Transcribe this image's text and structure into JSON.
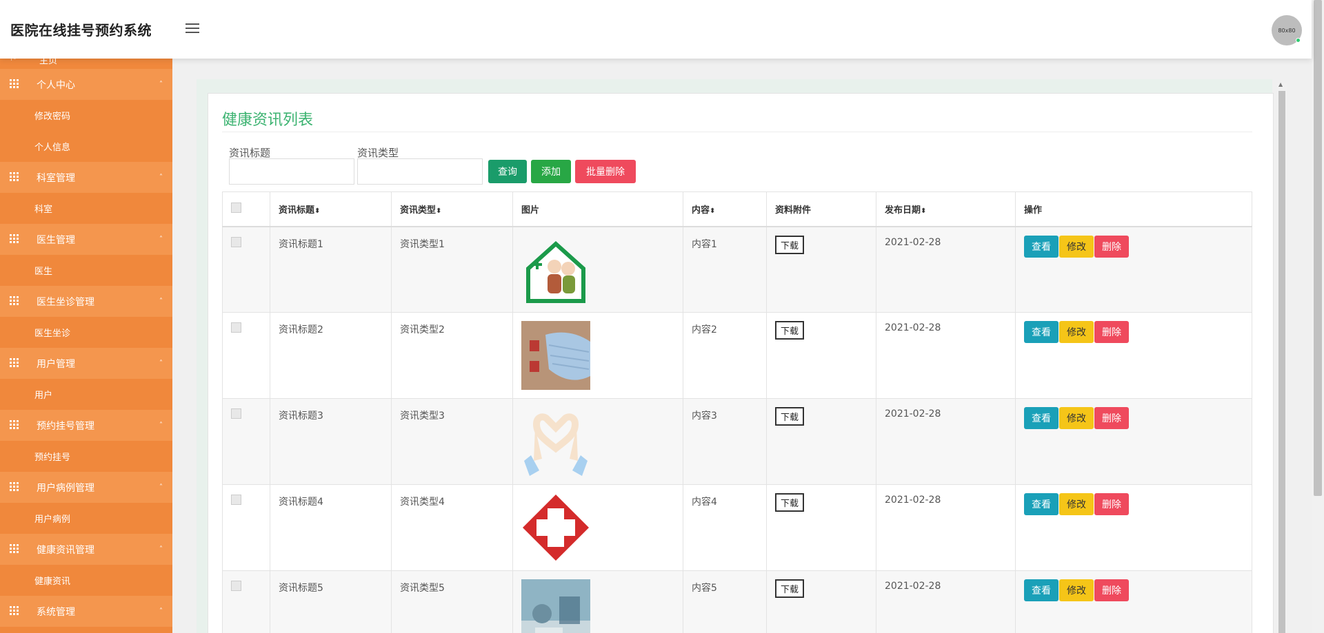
{
  "app": {
    "title": "医院在线挂号预约系统",
    "avatar_text": "80x80"
  },
  "sidebar": {
    "home": "主页",
    "groups": [
      {
        "label": "个人中心",
        "items": [
          "修改密码",
          "个人信息"
        ]
      },
      {
        "label": "科室管理",
        "items": [
          "科室"
        ]
      },
      {
        "label": "医生管理",
        "items": [
          "医生"
        ]
      },
      {
        "label": "医生坐诊管理",
        "items": [
          "医生坐诊"
        ]
      },
      {
        "label": "用户管理",
        "items": [
          "用户"
        ]
      },
      {
        "label": "预约挂号管理",
        "items": [
          "预约挂号"
        ]
      },
      {
        "label": "用户病例管理",
        "items": [
          "用户病例"
        ]
      },
      {
        "label": "健康资讯管理",
        "items": [
          "健康资讯"
        ]
      },
      {
        "label": "系统管理",
        "items": []
      }
    ]
  },
  "page": {
    "title": "健康资讯列表",
    "search": {
      "title_label": "资讯标题",
      "type_label": "资讯类型",
      "title_value": "",
      "type_value": ""
    },
    "buttons": {
      "query": "查询",
      "add": "添加",
      "batch_delete": "批量删除"
    },
    "colors": {
      "query": "#1a9c6a",
      "add": "#28a745",
      "batch_delete": "#ef4a5d",
      "sidebar": "#f0883c",
      "title": "#3cb371"
    }
  },
  "table": {
    "headers": {
      "title": "资讯标题",
      "type": "资讯类型",
      "image": "图片",
      "content": "内容",
      "attachment": "资料附件",
      "date": "发布日期",
      "ops": "操作"
    },
    "sort_glyph": "⬍",
    "rows": [
      {
        "title": "资讯标题1",
        "type": "资讯类型1",
        "image": "elderly-house-icon",
        "content": "内容1",
        "download": "下载",
        "date": "2021-02-28"
      },
      {
        "title": "资讯标题2",
        "type": "资讯类型2",
        "image": "mask-photo",
        "content": "内容2",
        "download": "下载",
        "date": "2021-02-28"
      },
      {
        "title": "资讯标题3",
        "type": "资讯类型3",
        "image": "heart-hands-icon",
        "content": "内容3",
        "download": "下载",
        "date": "2021-02-28"
      },
      {
        "title": "资讯标题4",
        "type": "资讯类型4",
        "image": "red-cross-icon",
        "content": "内容4",
        "download": "下载",
        "date": "2021-02-28"
      },
      {
        "title": "资讯标题5",
        "type": "资讯类型5",
        "image": "hospital-photo",
        "content": "内容5",
        "download": "下载",
        "date": "2021-02-28"
      }
    ],
    "actions": {
      "view": "查看",
      "edit": "修改",
      "delete": "删除"
    }
  }
}
